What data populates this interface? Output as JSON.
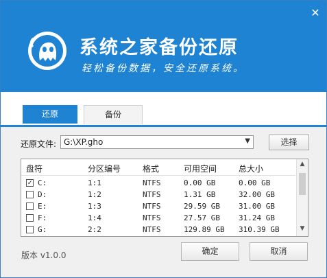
{
  "window": {
    "title": "系统之家备份还原",
    "subtitle": "轻松备份数据，安全还原系统。",
    "close_symbol": "✕"
  },
  "colors": {
    "brand_blue": "#1e83d3",
    "header_text": "#ffffff"
  },
  "icons": {
    "logo": "ghost-logo-icon",
    "close": "close-icon",
    "dropdown": "chevron-down-icon",
    "check": "checkmark-icon"
  },
  "tabs": [
    {
      "label": "还原",
      "active": true
    },
    {
      "label": "备份",
      "active": false
    }
  ],
  "file": {
    "label": "还原文件:",
    "value": "G:\\XP.gho",
    "choose_label": "选择"
  },
  "table": {
    "headers": [
      "盘符",
      "分区编号",
      "格式",
      "可用空间",
      "总大小"
    ],
    "rows": [
      {
        "checked": true,
        "drive": "C:",
        "partition": "1:1",
        "format": "NTFS",
        "free": "0.00 GB",
        "total": "0.00 GB"
      },
      {
        "checked": false,
        "drive": "D:",
        "partition": "1:2",
        "format": "NTFS",
        "free": "1.31 GB",
        "total": "32.00 GB"
      },
      {
        "checked": false,
        "drive": "E:",
        "partition": "1:3",
        "format": "NTFS",
        "free": "29.59 GB",
        "total": "31.00 GB"
      },
      {
        "checked": false,
        "drive": "F:",
        "partition": "1:4",
        "format": "NTFS",
        "free": "27.57 GB",
        "total": "31.24 GB"
      },
      {
        "checked": false,
        "drive": "G:",
        "partition": "2:2",
        "format": "NTFS",
        "free": "129.89 GB",
        "total": "310.39 GB"
      }
    ]
  },
  "footer": {
    "version": "版本 v1.0.0",
    "ok_label": "确定",
    "cancel_label": "取消"
  }
}
